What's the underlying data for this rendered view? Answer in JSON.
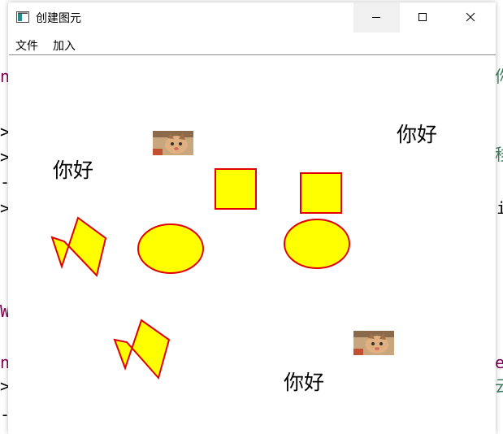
{
  "window": {
    "title": "创建图元"
  },
  "menu": [
    {
      "label": "文件"
    },
    {
      "label": "加入"
    }
  ],
  "canvas_texts": [
    {
      "text": "你好"
    },
    {
      "text": "你好"
    },
    {
      "text": "你好"
    }
  ],
  "background_fragments": [
    {
      "text": "nt",
      "color": "#7f0055"
    },
    {
      "text": ">s",
      "color": "#000000"
    },
    {
      "text": ">s",
      "color": "#000000"
    },
    {
      "text": "-;",
      "color": "#000000"
    },
    {
      "text": ">s",
      "color": "#000000"
    },
    {
      "text": "W",
      "color": "#7f0055"
    },
    {
      "text": "nt",
      "color": "#7f0055"
    },
    {
      "text": ">s",
      "color": "#000000"
    },
    {
      "text": "-;",
      "color": "#000000"
    },
    {
      "text": "你",
      "color": "#3f7f5f"
    },
    {
      "text": "移",
      "color": "#3f7f5f"
    },
    {
      "text": "i",
      "color": "#000000"
    },
    {
      "text": "e",
      "color": "#7f0055"
    },
    {
      "text": "云",
      "color": "#3f7f5f"
    }
  ],
  "colors": {
    "shape_fill": "#ffff00",
    "shape_stroke": "#e00000",
    "canvas_bg": "#ffffff"
  },
  "icons": [
    "app-icon",
    "minimize-icon",
    "maximize-icon",
    "close-icon",
    "cat-image"
  ]
}
